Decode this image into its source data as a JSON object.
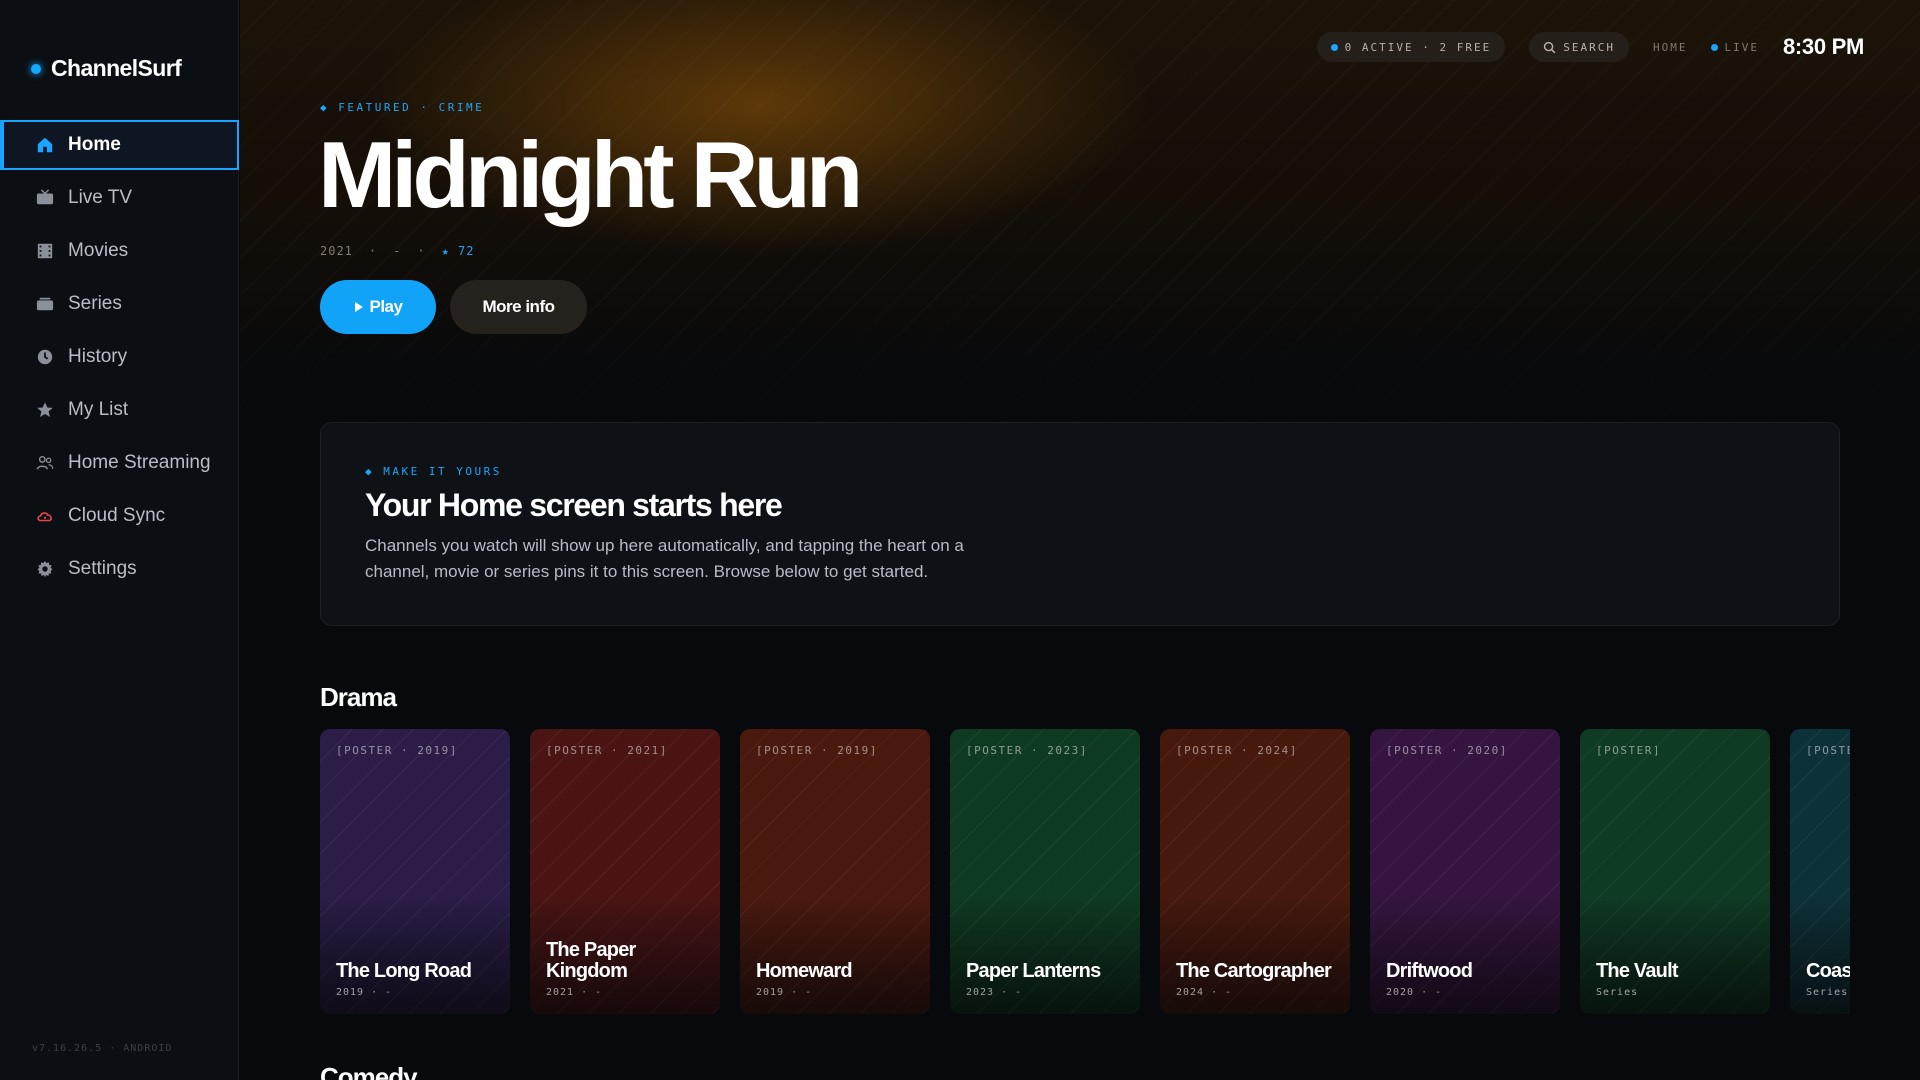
{
  "app": {
    "name": "ChannelSurf",
    "version": "v7.16.26.5 · ANDROID"
  },
  "sidebar": {
    "items": [
      {
        "label": "Home",
        "icon": "home-icon"
      },
      {
        "label": "Live TV",
        "icon": "tv-icon"
      },
      {
        "label": "Movies",
        "icon": "film-icon"
      },
      {
        "label": "Series",
        "icon": "series-icon"
      },
      {
        "label": "History",
        "icon": "clock-icon"
      },
      {
        "label": "My List",
        "icon": "star-icon"
      },
      {
        "label": "Home Streaming",
        "icon": "users-icon"
      },
      {
        "label": "Cloud Sync",
        "icon": "cloud-icon"
      },
      {
        "label": "Settings",
        "icon": "gear-icon"
      }
    ]
  },
  "topbar": {
    "status": "0 ACTIVE · 2 FREE",
    "search": "SEARCH",
    "home": "HOME",
    "live": "LIVE",
    "time": "8:30 PM"
  },
  "hero": {
    "tag": "◆ FEATURED · CRIME",
    "title": "Midnight Run",
    "year": "2021",
    "sep1": "·",
    "dash": "-",
    "sep2": "·",
    "rating": "★ 72",
    "play_label": "Play",
    "info_label": "More info"
  },
  "intro": {
    "tag": "◆ MAKE IT YOURS",
    "title": "Your Home screen starts here",
    "body": "Channels you watch will show up here automatically, and tapping the heart on a channel, movie or series pins it to this screen. Browse below to get started."
  },
  "rows": [
    {
      "title": "Drama",
      "cards": [
        {
          "tag": "[POSTER · 2019]",
          "title": "The Long Road",
          "sub": "2019 · -",
          "color": "#2b1d48"
        },
        {
          "tag": "[POSTER · 2021]",
          "title": "The Paper Kingdom",
          "sub": "2021 · -",
          "color": "#4a1414"
        },
        {
          "tag": "[POSTER · 2019]",
          "title": "Homeward",
          "sub": "2019 · -",
          "color": "#4a190e"
        },
        {
          "tag": "[POSTER · 2023]",
          "title": "Paper Lanterns",
          "sub": "2023 · -",
          "color": "#0f3a22"
        },
        {
          "tag": "[POSTER · 2024]",
          "title": "The Cartographer",
          "sub": "2024 · -",
          "color": "#47190d"
        },
        {
          "tag": "[POSTER · 2020]",
          "title": "Driftwood",
          "sub": "2020 · -",
          "color": "#35153f"
        },
        {
          "tag": "[POSTER]",
          "title": "The Vault",
          "sub": "Series",
          "color": "#0f3a24"
        },
        {
          "tag": "[POSTER]",
          "title": "Coast",
          "sub": "Series",
          "color": "#0d3138"
        }
      ]
    },
    {
      "title": "Comedy"
    }
  ],
  "colors": {
    "accent": "#19a4ff"
  }
}
